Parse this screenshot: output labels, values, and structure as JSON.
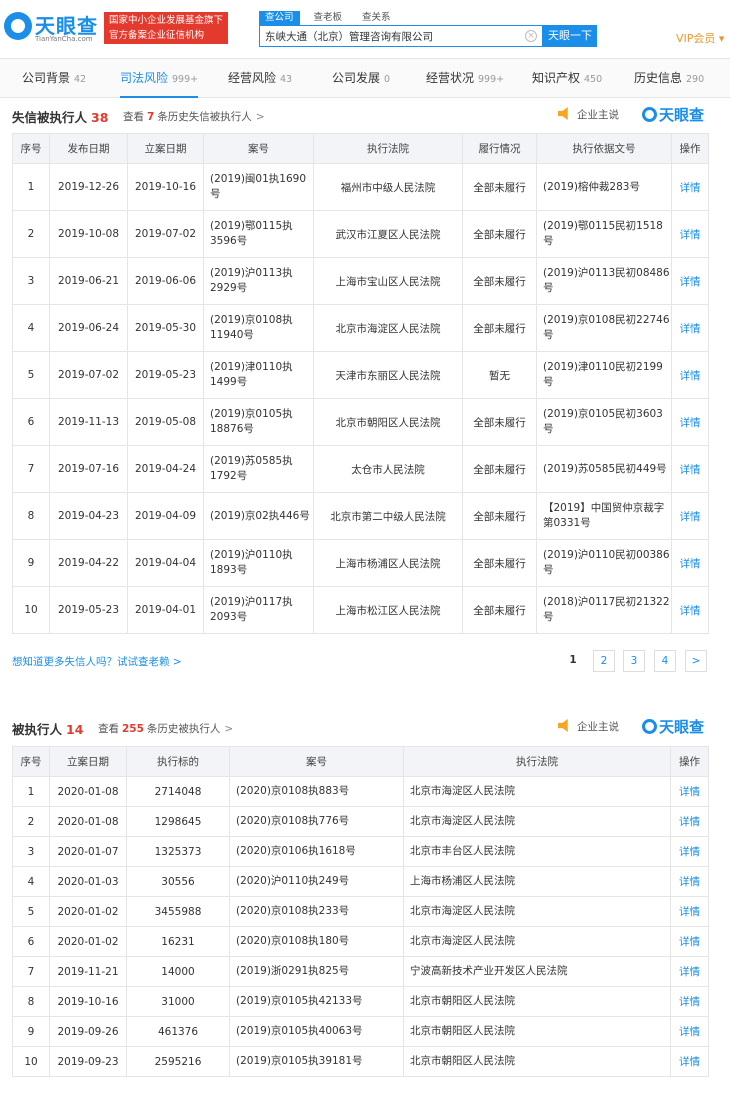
{
  "header": {
    "logo_text": "天眼查",
    "logo_sub": "TianYanCha.com",
    "red_box_line1": "国家中小企业发展基金旗下",
    "red_box_line2": "官方备案企业征信机构",
    "search_tabs": [
      "查公司",
      "查老板",
      "查关系"
    ],
    "search_value": "东峡大通（北京）管理咨询有限公司",
    "search_button": "天眼一下",
    "vip": "VIP会员 ▾"
  },
  "nav": [
    {
      "label": "公司背景",
      "count": "42"
    },
    {
      "label": "司法风险",
      "count": "999+"
    },
    {
      "label": "经营风险",
      "count": "43"
    },
    {
      "label": "公司发展",
      "count": "0"
    },
    {
      "label": "经营状况",
      "count": "999+"
    },
    {
      "label": "知识产权",
      "count": "450"
    },
    {
      "label": "历史信息",
      "count": "290"
    }
  ],
  "section1": {
    "title": "失信被执行人",
    "count": "38",
    "hist_prefix": "查看",
    "hist_count": "7",
    "hist_suffix": "条历史失信被执行人",
    "hist_arrow": ">",
    "speak": "企业主说",
    "brand": "天眼查",
    "headers": [
      "序号",
      "发布日期",
      "立案日期",
      "案号",
      "执行法院",
      "履行情况",
      "执行依据文号",
      "操作"
    ],
    "rows": [
      [
        "1",
        "2019-12-26",
        "2019-10-16",
        "(2019)闽01执1690号",
        "福州市中级人民法院",
        "全部未履行",
        "(2019)榕仲裁283号",
        "详情"
      ],
      [
        "2",
        "2019-10-08",
        "2019-07-02",
        "(2019)鄂0115执3596号",
        "武汉市江夏区人民法院",
        "全部未履行",
        "(2019)鄂0115民初1518号",
        "详情"
      ],
      [
        "3",
        "2019-06-21",
        "2019-06-06",
        "(2019)沪0113执2929号",
        "上海市宝山区人民法院",
        "全部未履行",
        "(2019)沪0113民初08486号",
        "详情"
      ],
      [
        "4",
        "2019-06-24",
        "2019-05-30",
        "(2019)京0108执11940号",
        "北京市海淀区人民法院",
        "全部未履行",
        "(2019)京0108民初22746号",
        "详情"
      ],
      [
        "5",
        "2019-07-02",
        "2019-05-23",
        "(2019)津0110执1499号",
        "天津市东丽区人民法院",
        "暂无",
        "(2019)津0110民初2199号",
        "详情"
      ],
      [
        "6",
        "2019-11-13",
        "2019-05-08",
        "(2019)京0105执18876号",
        "北京市朝阳区人民法院",
        "全部未履行",
        "(2019)京0105民初3603号",
        "详情"
      ],
      [
        "7",
        "2019-07-16",
        "2019-04-24",
        "(2019)苏0585执1792号",
        "太仓市人民法院",
        "全部未履行",
        "(2019)苏0585民初449号",
        "详情"
      ],
      [
        "8",
        "2019-04-23",
        "2019-04-09",
        "(2019)京02执446号",
        "北京市第二中级人民法院",
        "全部未履行",
        "【2019】中国贸仲京裁字第0331号",
        "详情"
      ],
      [
        "9",
        "2019-04-22",
        "2019-04-04",
        "(2019)沪0110执1893号",
        "上海市杨浦区人民法院",
        "全部未履行",
        "(2019)沪0110民初00386号",
        "详情"
      ],
      [
        "10",
        "2019-05-23",
        "2019-04-01",
        "(2019)沪0117执2093号",
        "上海市松江区人民法院",
        "全部未履行",
        "(2018)沪0117民初21322号",
        "详情"
      ]
    ],
    "more_text": "想知道更多失信人吗？试试查老赖 >",
    "pages": [
      "1",
      "2",
      "3",
      "4",
      ">"
    ]
  },
  "section2": {
    "title": "被执行人",
    "count": "14",
    "hist_prefix": "查看",
    "hist_count": "255",
    "hist_suffix": "条历史被执行人",
    "hist_arrow": ">",
    "speak": "企业主说",
    "brand": "天眼查",
    "headers": [
      "序号",
      "立案日期",
      "执行标的",
      "案号",
      "执行法院",
      "操作"
    ],
    "rows": [
      [
        "1",
        "2020-01-08",
        "2714048",
        "(2020)京0108执883号",
        "北京市海淀区人民法院",
        "详情"
      ],
      [
        "2",
        "2020-01-08",
        "1298645",
        "(2020)京0108执776号",
        "北京市海淀区人民法院",
        "详情"
      ],
      [
        "3",
        "2020-01-07",
        "1325373",
        "(2020)京0106执1618号",
        "北京市丰台区人民法院",
        "详情"
      ],
      [
        "4",
        "2020-01-03",
        "30556",
        "(2020)沪0110执249号",
        "上海市杨浦区人民法院",
        "详情"
      ],
      [
        "5",
        "2020-01-02",
        "3455988",
        "(2020)京0108执233号",
        "北京市海淀区人民法院",
        "详情"
      ],
      [
        "6",
        "2020-01-02",
        "16231",
        "(2020)京0108执180号",
        "北京市海淀区人民法院",
        "详情"
      ],
      [
        "7",
        "2019-11-21",
        "14000",
        "(2019)浙0291执825号",
        "宁波高新技术产业开发区人民法院",
        "详情"
      ],
      [
        "8",
        "2019-10-16",
        "31000",
        "(2019)京0105执42133号",
        "北京市朝阳区人民法院",
        "详情"
      ],
      [
        "9",
        "2019-09-26",
        "461376",
        "(2019)京0105执40063号",
        "北京市朝阳区人民法院",
        "详情"
      ],
      [
        "10",
        "2019-09-23",
        "2595216",
        "(2019)京0105执39181号",
        "北京市朝阳区人民法院",
        "详情"
      ]
    ]
  },
  "colors": {
    "brand_blue": "#1a8ee8",
    "alert_red": "#e33a2d",
    "vip_orange": "#e89a2e"
  }
}
